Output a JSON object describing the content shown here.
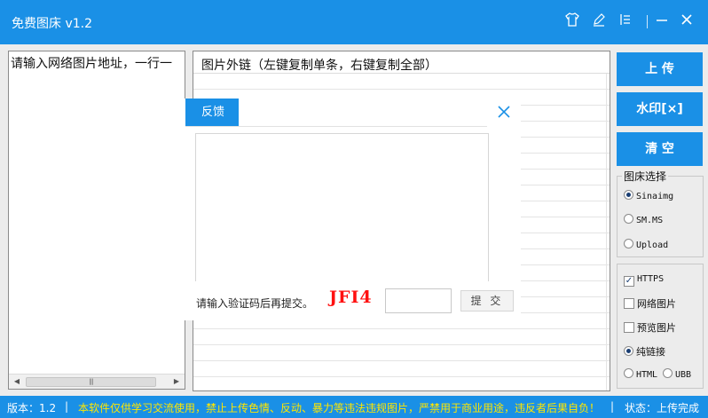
{
  "window": {
    "title": "免费图床 v1.2"
  },
  "titlebar_icons": [
    "shirt-icon",
    "edit-icon",
    "menu-icon",
    "minimize-icon",
    "close-icon"
  ],
  "left_panel": {
    "placeholder_text": "请输入网络图片地址，一行一"
  },
  "list": {
    "header": "图片外链（左键复制单条，右键复制全部）"
  },
  "dialog": {
    "tab_label": "反馈",
    "hint": "请输入验证码后再提交。",
    "captcha": "JFI4",
    "submit_label": "提 交"
  },
  "buttons": {
    "upload": "上 传",
    "watermark": "水印[×]",
    "clear": "清 空"
  },
  "host_group": {
    "title": "图床选择",
    "options": [
      "Sinaimg",
      "SM.MS",
      "Upload"
    ],
    "selected": "Sinaimg"
  },
  "options_group": {
    "https_label": "HTTPS",
    "https_checked": true,
    "net_image_label": "网络图片",
    "net_image_checked": false,
    "preview_label": "预览图片",
    "preview_checked": false,
    "pure_link_label": "纯链接",
    "html_label": "HTML",
    "ubb_label": "UBB",
    "selected_format": "纯链接"
  },
  "statusbar": {
    "version": "版本：1.2",
    "sep": "|",
    "notice": "本软件仅供学习交流使用，禁止上传色情、反动、暴力等违法违规图片，严禁用于商业用途，违反者后果自负！",
    "status": "状态：上传完成"
  },
  "colors": {
    "accent": "#1a90e6",
    "warning": "#ffe600",
    "captcha": "#ff1010"
  }
}
